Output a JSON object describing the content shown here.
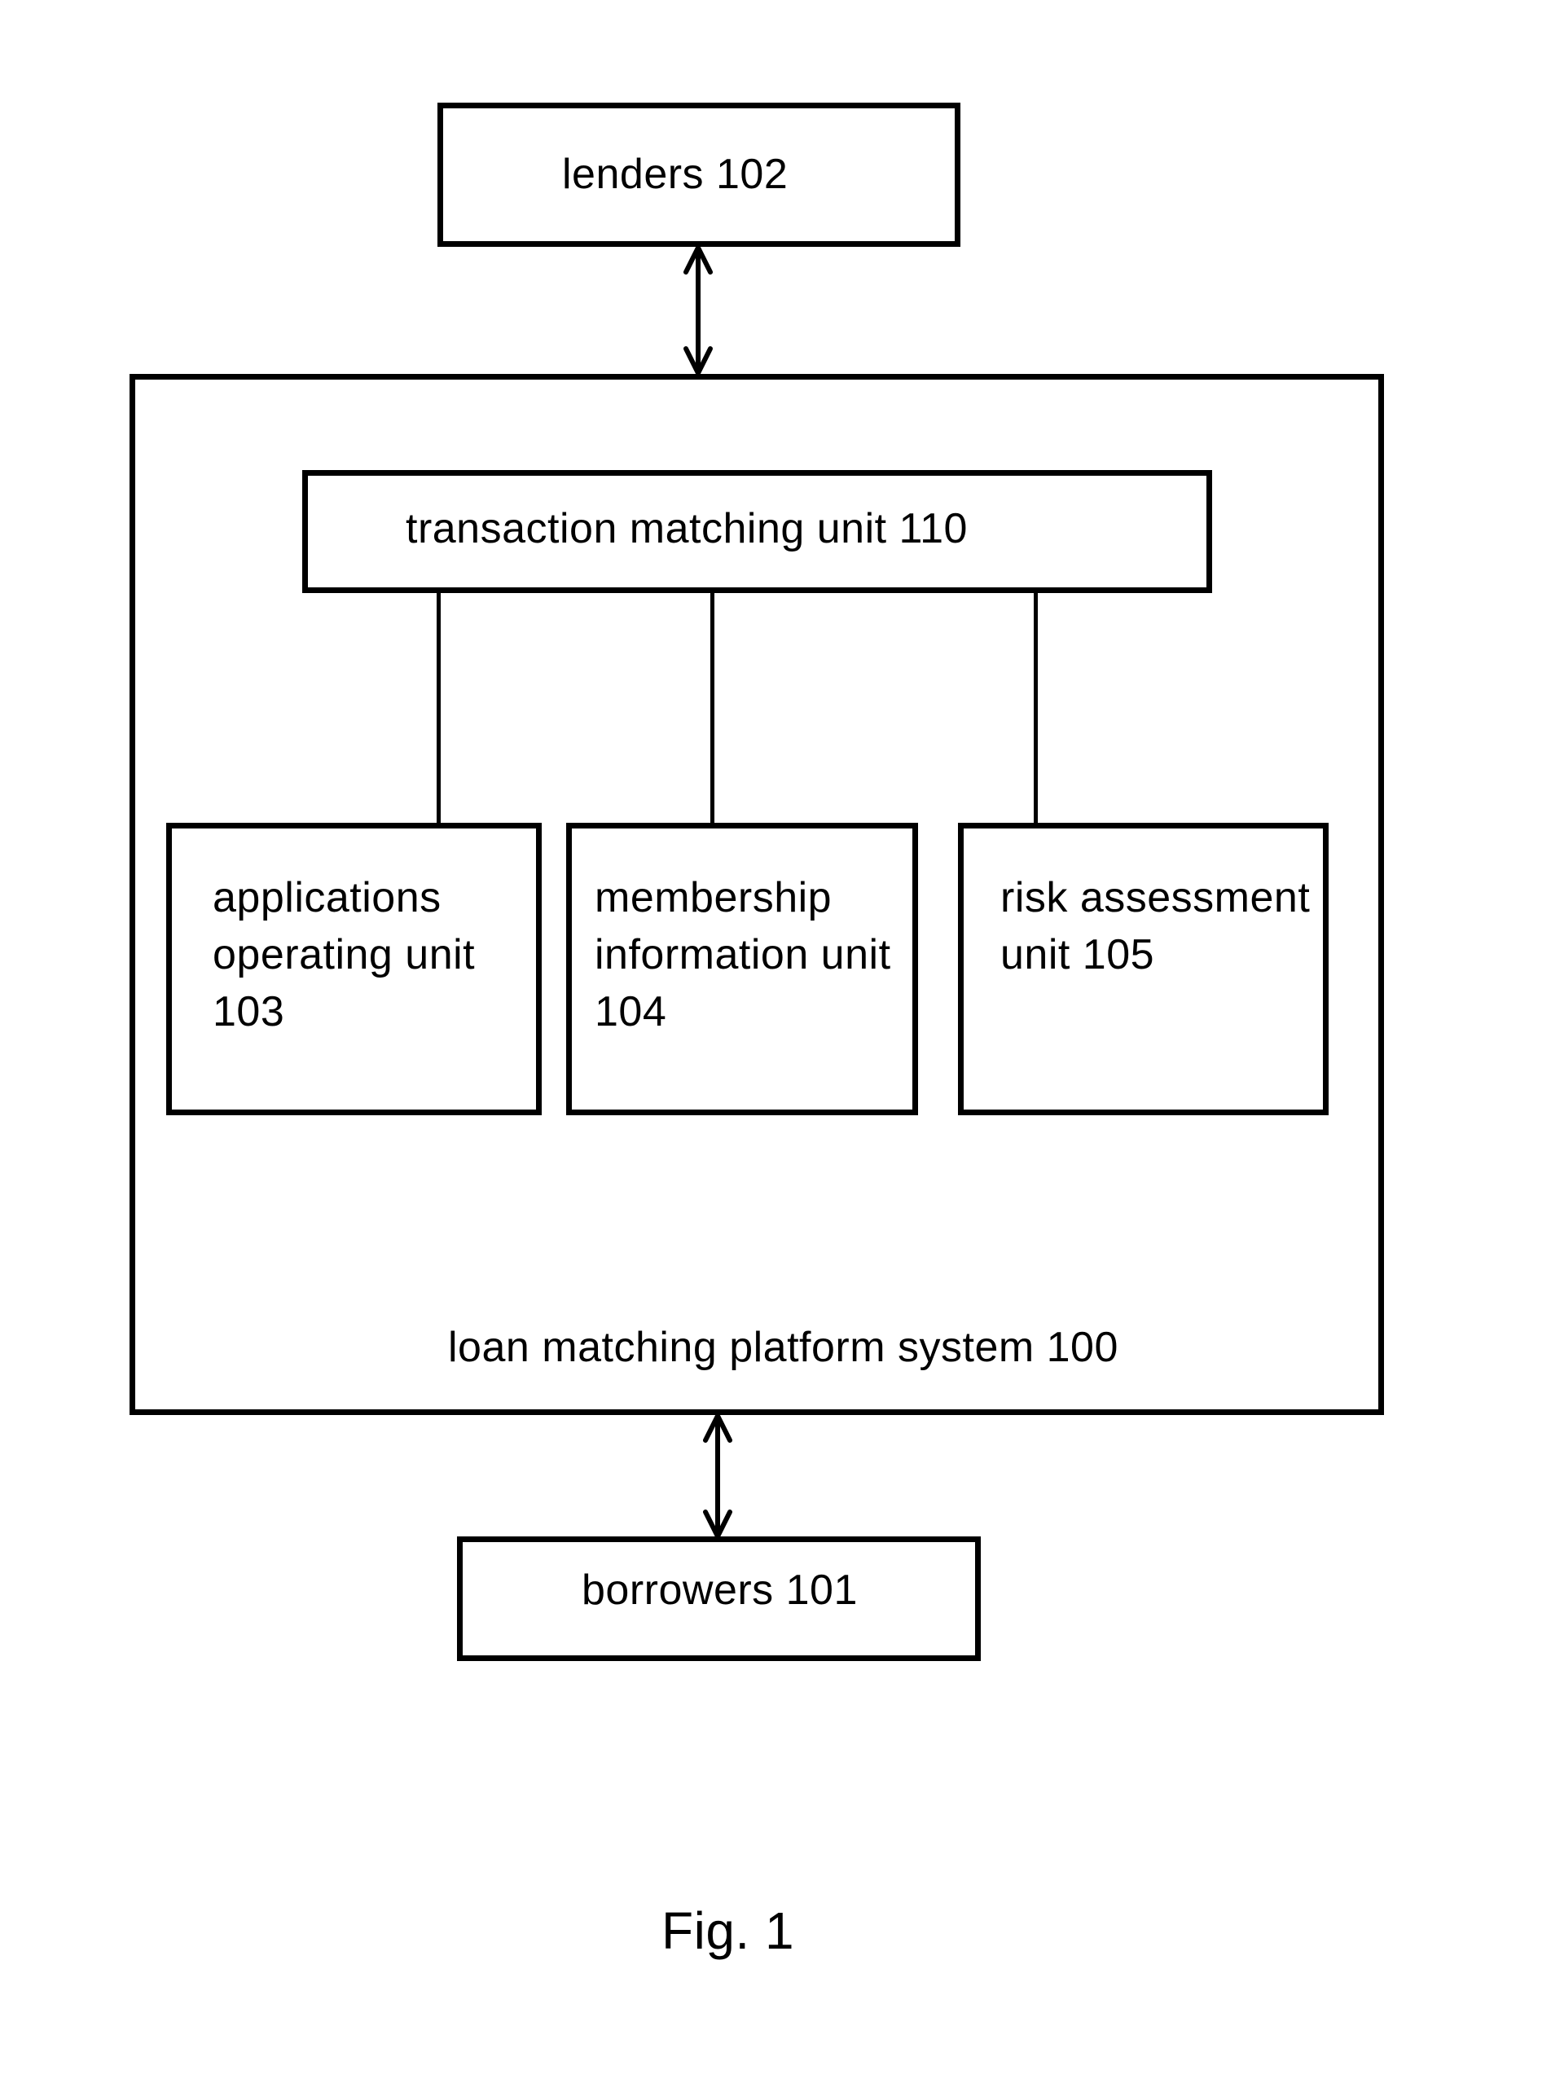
{
  "diagram": {
    "external": {
      "lenders": "lenders 102",
      "borrowers": "borrowers 101"
    },
    "platform": {
      "label": "loan matching platform system 100",
      "transaction_unit": "transaction matching unit 110",
      "units": [
        {
          "label": "applications\noperating unit\n103"
        },
        {
          "label": "membership\ninformation unit\n104"
        },
        {
          "label": "risk assessment\nunit 105"
        }
      ]
    },
    "connections": [
      {
        "from": "lenders 102",
        "to": "loan matching platform system 100",
        "type": "bidirectional-arrow"
      },
      {
        "from": "loan matching platform system 100",
        "to": "borrowers 101",
        "type": "bidirectional-arrow"
      },
      {
        "from": "transaction matching unit 110",
        "to": "applications operating unit 103",
        "type": "line"
      },
      {
        "from": "transaction matching unit 110",
        "to": "membership information unit 104",
        "type": "line"
      },
      {
        "from": "transaction matching unit 110",
        "to": "risk assessment unit 105",
        "type": "line"
      }
    ],
    "figure_caption": "Fig. 1"
  }
}
